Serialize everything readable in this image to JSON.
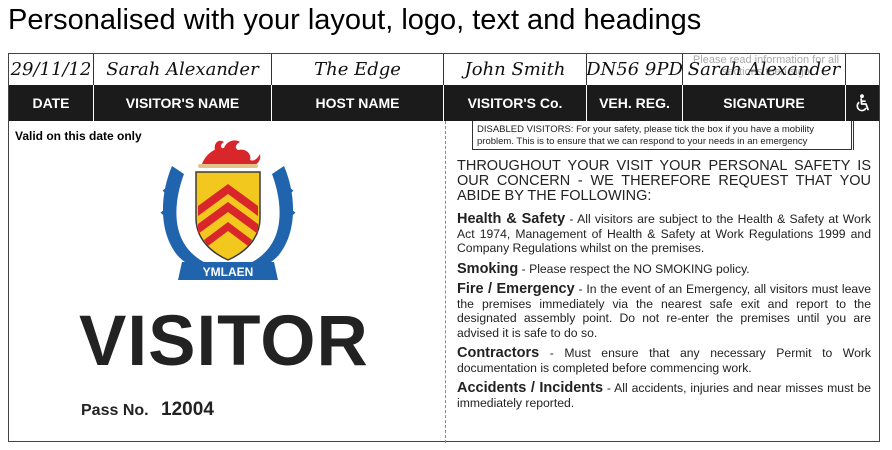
{
  "headline": "Personalised with your layout, logo, text and headings",
  "handwritten": {
    "date": "29/11/12",
    "visitor_name": "Sarah Alexander",
    "host_name": "The Edge",
    "visitor_company": "John Smith",
    "vehicle_reg": "DN56 9PD",
    "signature": "Sarah Alexander",
    "signature_hint": "Please read information for all sections then sign"
  },
  "columns": {
    "date": "DATE",
    "visitor_name": "VISITOR'S NAME",
    "host_name": "HOST NAME",
    "visitor_company": "VISITOR'S Co.",
    "vehicle_reg": "VEH. REG.",
    "signature": "SIGNATURE",
    "accessibility_icon": "wheelchair-icon"
  },
  "valid_note": "Valid on this date only",
  "crest": {
    "motto": "YMLAEN",
    "colors": {
      "shield": "#f2c81f",
      "chevrons": "#d8262b",
      "dragon": "#d8262b",
      "mantling": "#1f64ad"
    }
  },
  "visitor_label": "VISITOR",
  "pass": {
    "label": "Pass No.",
    "number": "12004"
  },
  "disabled_note": "DISABLED VISITORS: For your safety, please tick the box if you have a mobility problem. This is to ensure that we can respond to your needs in an emergency",
  "intro": "THROUGHOUT YOUR VISIT YOUR PERSONAL SAFETY IS OUR CONCERN - WE THEREFORE REQUEST THAT YOU ABIDE BY THE FOLLOWING:",
  "rules": [
    {
      "title": "Health & Safety",
      "text": " - All visitors are subject to the Health & Safety at Work Act 1974, Management of Health & Safety at Work Regulations 1999 and Company Regulations whilst on the premises."
    },
    {
      "title": "Smoking",
      "text": " - Please respect the NO SMOKING policy."
    },
    {
      "title": "Fire / Emergency",
      "text": " - In the event of an Emergency, all visitors must leave the premises immediately via the nearest safe exit and report to the designated assembly point. Do not re-enter the premises until you are advised it is safe to do so."
    },
    {
      "title": "Contractors",
      "text": " - Must ensure that any necessary Permit to Work documentation is completed before commencing work."
    },
    {
      "title": "Accidents / Incidents",
      "text": " - All accidents, injuries and near misses must be immediately reported."
    }
  ]
}
